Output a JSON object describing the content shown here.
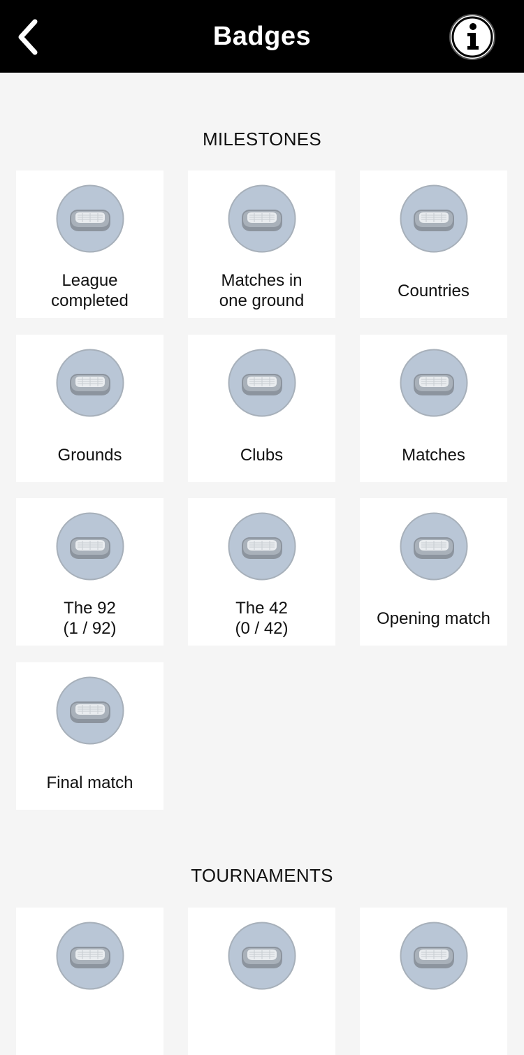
{
  "header": {
    "title": "Badges",
    "back_icon": "chevron-left-icon",
    "info_icon": "info-icon"
  },
  "sections": {
    "milestones": {
      "title": "MILESTONES",
      "badges": [
        {
          "label": "League\ncompleted"
        },
        {
          "label": "Matches in\none ground"
        },
        {
          "label": "Countries"
        },
        {
          "label": "Grounds"
        },
        {
          "label": "Clubs"
        },
        {
          "label": "Matches"
        },
        {
          "label": "The 92\n(1 / 92)"
        },
        {
          "label": "The 42\n(0 / 42)"
        },
        {
          "label": "Opening match"
        },
        {
          "label": "Final match"
        }
      ]
    },
    "tournaments": {
      "title": "TOURNAMENTS"
    }
  },
  "colors": {
    "header_bg": "#000000",
    "page_bg": "#f5f5f5",
    "card_bg": "#ffffff",
    "badge_circle": "#b9c6d6",
    "badge_border": "#9ca6b0",
    "stadium": "#8e96a0"
  }
}
